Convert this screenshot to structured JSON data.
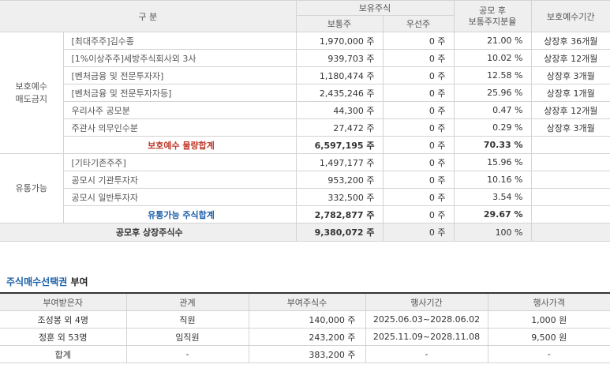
{
  "lockup_table": {
    "headers": {
      "category": "구    분",
      "held_shares": "보유주식",
      "common": "보통주",
      "preferred": "우선주",
      "ratio": "공모 후\n보통주지분율",
      "period": "보호예수기간"
    },
    "group_protected": "보호예수\n매도금지",
    "group_tradable": "유통가능",
    "rows": [
      {
        "label": "[최대주주]김수종",
        "common": "1,970,000 주",
        "preferred": "0 주",
        "ratio": "21.00 %",
        "period": "상장후 36개월"
      },
      {
        "label": "[1%이상주주]세방주식회사외 3사",
        "common": "939,703 주",
        "preferred": "0 주",
        "ratio": "10.02 %",
        "period": "상장후 12개월"
      },
      {
        "label": "[벤처금융 및 전문투자자]",
        "common": "1,180,474 주",
        "preferred": "0 주",
        "ratio": "12.58 %",
        "period": "상장후 3개월"
      },
      {
        "label": "[벤처금융 및 전문투자자등]",
        "common": "2,435,246 주",
        "preferred": "0 주",
        "ratio": "25.96 %",
        "period": "상장후 1개월"
      },
      {
        "label": "우리사주 공모분",
        "common": "44,300 주",
        "preferred": "0 주",
        "ratio": "0.47 %",
        "period": "상장후 12개월"
      },
      {
        "label": "주관사 의무인수분",
        "common": "27,472 주",
        "preferred": "0 주",
        "ratio": "0.29 %",
        "period": "상장후 3개월"
      }
    ],
    "protected_sum": {
      "label": "보호예수 물량합계",
      "common": "6,597,195 주",
      "preferred": "0 주",
      "ratio": "70.33 %"
    },
    "tradable_rows": [
      {
        "label": "[기타기존주주]",
        "common": "1,497,177 주",
        "preferred": "0 주",
        "ratio": "15.96 %"
      },
      {
        "label": "공모시 기관투자자",
        "common": "953,200 주",
        "preferred": "0 주",
        "ratio": "10.16 %"
      },
      {
        "label": "공모시 일반투자자",
        "common": "332,500 주",
        "preferred": "0 주",
        "ratio": "3.54 %"
      }
    ],
    "tradable_sum": {
      "label": "유통가능 주식합계",
      "common": "2,782,877 주",
      "preferred": "0 주",
      "ratio": "29.67 %"
    },
    "total": {
      "label": "공모후 상장주식수",
      "common": "9,380,072 주",
      "preferred": "0 주",
      "ratio": "100 %"
    }
  },
  "options_section": {
    "title_highlight": "주식매수선택권",
    "title_rest": " 부여",
    "headers": [
      "부여받은자",
      "관계",
      "부여주식수",
      "행사기간",
      "행사가격"
    ],
    "rows": [
      {
        "grantee": "조성봉 외 4명",
        "relation": "직원",
        "shares": "140,000 주",
        "period": "2025.06.03~2028.06.02",
        "price": "1,000 원"
      },
      {
        "grantee": "정훈 외 53명",
        "relation": "임직원",
        "shares": "243,200 주",
        "period": "2025.11.09~2028.11.08",
        "price": "9,500 원"
      }
    ],
    "total": {
      "grantee": "합계",
      "relation": "-",
      "shares": "383,200 주",
      "period": "-",
      "price": "-"
    }
  }
}
